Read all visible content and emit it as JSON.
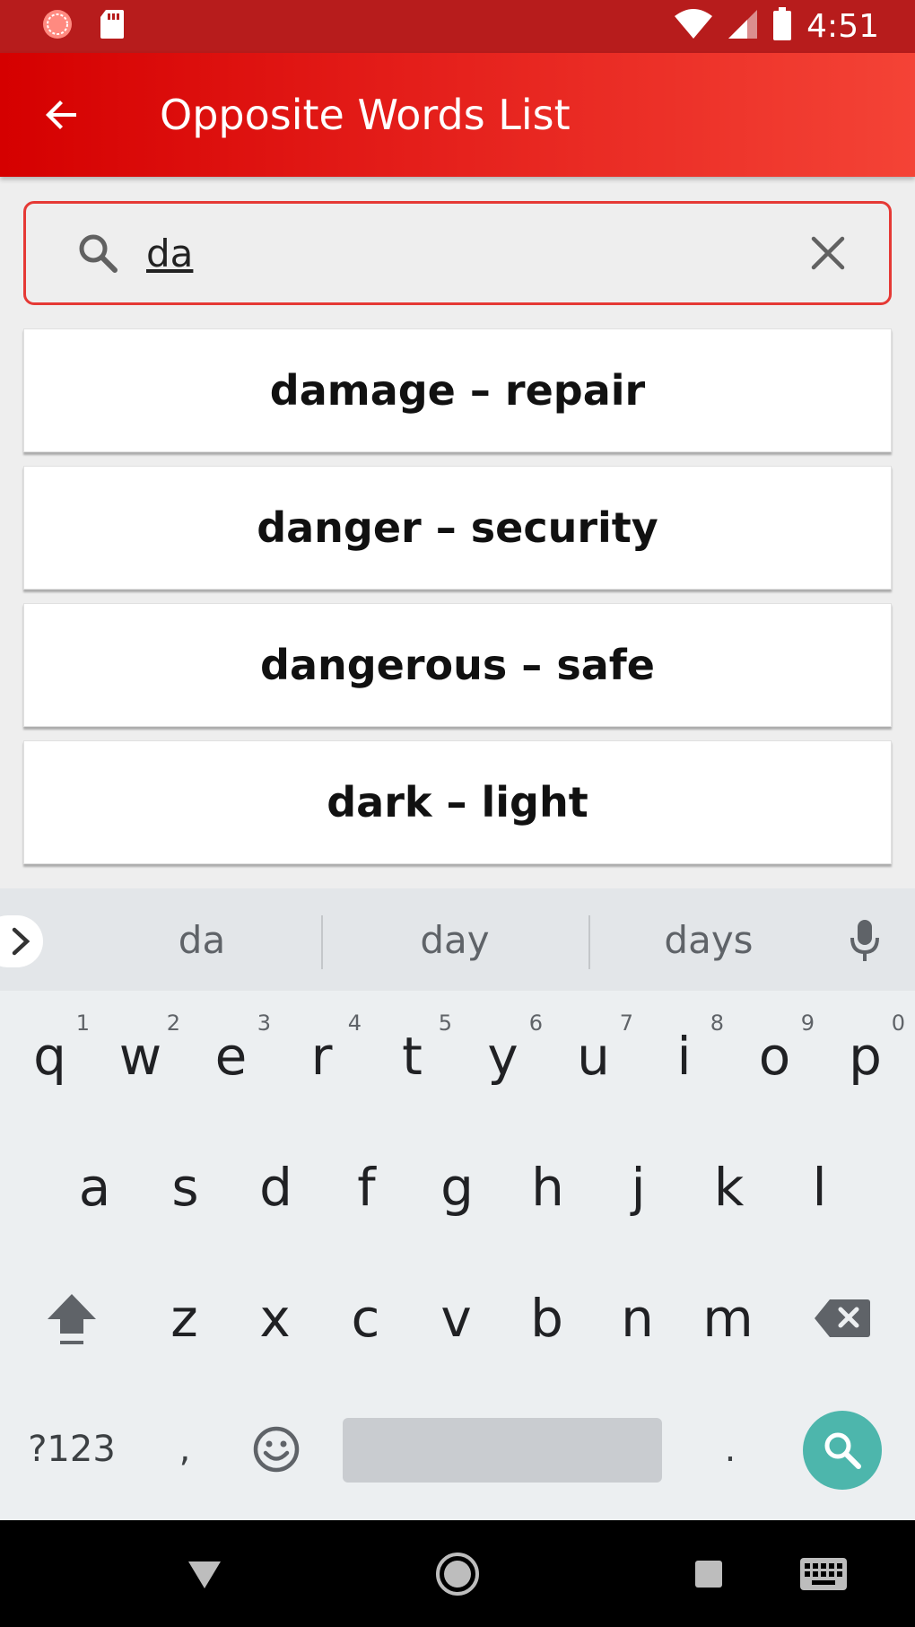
{
  "status_bar": {
    "time": "4:51",
    "icons": [
      "sync-icon",
      "sd-card-icon",
      "wifi-icon",
      "signal-icon",
      "battery-icon"
    ]
  },
  "app_bar": {
    "title": "Opposite Words List",
    "back_icon": "arrow-left-icon"
  },
  "search": {
    "value": "da",
    "placeholder": "",
    "accent": "#e53935"
  },
  "results": [
    {
      "text": "damage – repair"
    },
    {
      "text": "danger – security"
    },
    {
      "text": "dangerous – safe"
    },
    {
      "text": "dark – light"
    }
  ],
  "keyboard": {
    "suggestions": [
      "da",
      "day",
      "days"
    ],
    "row1": [
      {
        "key": "q",
        "hint": "1"
      },
      {
        "key": "w",
        "hint": "2"
      },
      {
        "key": "e",
        "hint": "3"
      },
      {
        "key": "r",
        "hint": "4"
      },
      {
        "key": "t",
        "hint": "5"
      },
      {
        "key": "y",
        "hint": "6"
      },
      {
        "key": "u",
        "hint": "7"
      },
      {
        "key": "i",
        "hint": "8"
      },
      {
        "key": "o",
        "hint": "9"
      },
      {
        "key": "p",
        "hint": "0"
      }
    ],
    "row2": [
      "a",
      "s",
      "d",
      "f",
      "g",
      "h",
      "j",
      "k",
      "l"
    ],
    "row3": [
      "z",
      "x",
      "c",
      "v",
      "b",
      "n",
      "m"
    ],
    "symbols_label": "?123",
    "comma": ",",
    "period": ".",
    "search_key_color": "#4db6ac"
  },
  "colors": {
    "status_bar": "#b71c1c",
    "app_bar_start": "#d50000",
    "app_bar_end": "#f44336"
  }
}
